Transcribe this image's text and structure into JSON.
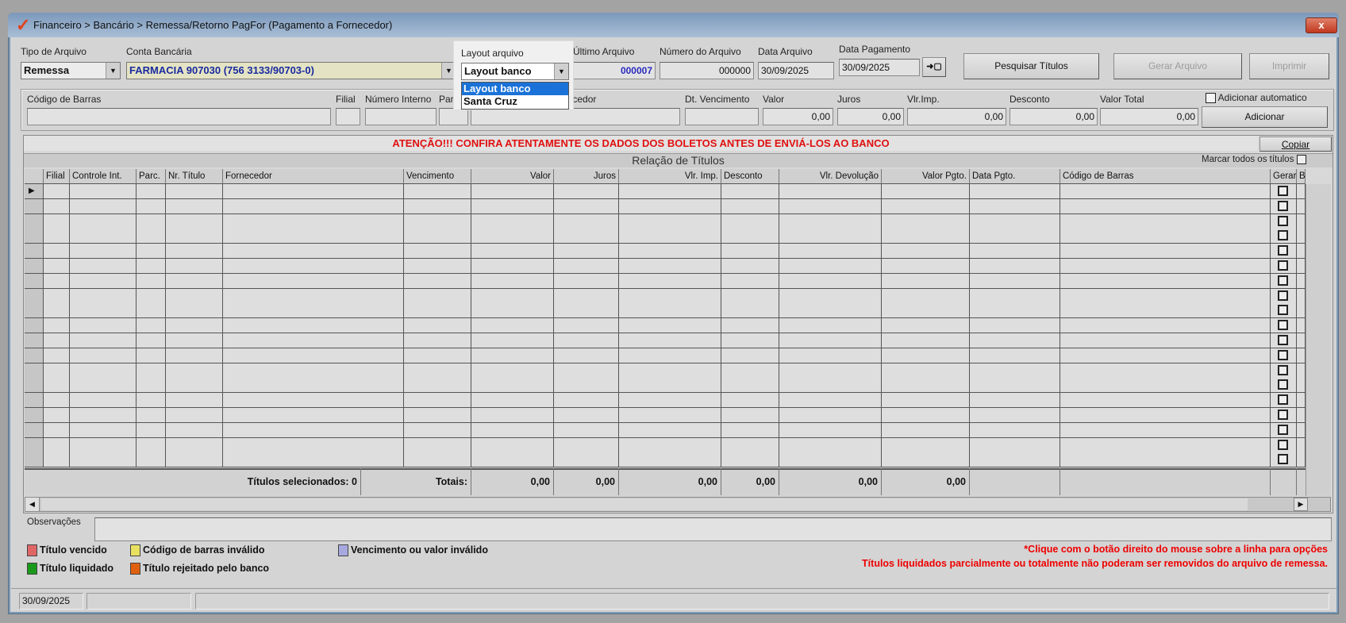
{
  "window": {
    "title": "Financeiro > Bancário > Remessa/Retorno PagFor (Pagamento  a Fornecedor)",
    "logo_icon": "check-logo-icon",
    "close_label": "x"
  },
  "top": {
    "tipo_label": "Tipo de Arquivo",
    "tipo_value": "Remessa",
    "conta_label": "Conta Bancária",
    "conta_value": "FARMACIA 907030 (756 3133/90703-0)",
    "layout_label": "Layout arquivo",
    "layout_value": "Layout banco",
    "layout_options": [
      "Layout banco",
      "Santa Cruz"
    ],
    "ultimo_label": "Último Arquivo",
    "ultimo_value": "000007",
    "numero_label": "Número do Arquivo",
    "numero_value": "000000",
    "data_arquivo_label": "Data Arquivo",
    "data_arquivo_value": "30/09/2025",
    "data_pagamento_label": "Data Pagamento",
    "data_pagamento_value": "30/09/2025",
    "apply_date_icon": "➜▢",
    "pesquisar_label": "Pesquisar Títulos",
    "gerar_label": "Gerar Arquivo",
    "imprimir_label": "Imprimir"
  },
  "entry": {
    "codigo_barras_label": "Código de Barras",
    "filial_label": "Filial",
    "numero_interno_label": "Número Interno",
    "parc_label": "Parc",
    "fornecedor_label": "Fornecedor",
    "vencimento_label": "Dt. Vencimento",
    "valor_label": "Valor",
    "valor_value": "0,00",
    "juros_label": "Juros",
    "juros_value": "0,00",
    "vlr_imp_label": "Vlr.Imp.",
    "vlr_imp_value": "0,00",
    "desconto_label": "Desconto",
    "desconto_value": "0,00",
    "valor_total_label": "Valor Total",
    "valor_total_value": "0,00",
    "auto_add_label": "Adicionar automatico",
    "adicionar_label": "Adicionar"
  },
  "grid": {
    "warning": "ATENÇÃO!!! CONFIRA ATENTAMENTE OS DADOS DOS BOLETOS ANTES DE ENVIÁ-LOS AO BANCO",
    "copiar_label": "Copiar",
    "section_title": "Relação de Títulos",
    "mark_all_label": "Marcar todos os títulos",
    "columns": [
      "Filial",
      "Controle Int.",
      "Parc.",
      "Nr. Título",
      "Fornecedor",
      "Vencimento",
      "Valor",
      "Juros",
      "Vlr. Imp.",
      "Desconto",
      "Vlr. Devolução",
      "Valor Pgto.",
      "Data Pgto.",
      "Código de Barras",
      "Gerar",
      "B"
    ],
    "empty_row_count": 19,
    "selected_label": "Títulos selecionados: 0",
    "totals_label": "Totais:",
    "totals": {
      "valor": "0,00",
      "juros": "0,00",
      "vlr_imp": "0,00",
      "desconto": "0,00",
      "vlr_devolucao": "0,00",
      "valor_pgto": "0,00"
    }
  },
  "obs_label": "Observações",
  "legend": [
    {
      "label": "Título vencido",
      "color": "#e06666"
    },
    {
      "label": "Código de barras inválido",
      "color": "#e8e060"
    },
    {
      "label": "Vencimento ou valor inválido",
      "color": "#a8a8e0"
    },
    {
      "label": "Título liquidado",
      "color": "#1a9a1a"
    },
    {
      "label": "Título rejeitado pelo banco",
      "color": "#e06010"
    }
  ],
  "notes": [
    "*Clique com o botão direito do mouse sobre a linha para opções",
    "Títulos liquidados parcialmente ou totalmente não poderam ser removidos do arquivo de remessa."
  ],
  "status": {
    "date": "30/09/2025"
  }
}
